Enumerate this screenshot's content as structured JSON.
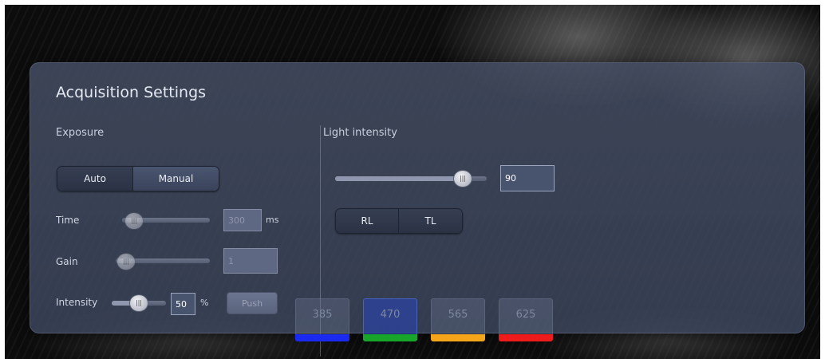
{
  "panel": {
    "title": "Acquisition Settings"
  },
  "exposure": {
    "label": "Exposure",
    "mode_options": [
      "Auto",
      "Manual"
    ],
    "time": {
      "label": "Time",
      "value": "300",
      "unit": "ms",
      "slider_fraction": 0.18
    },
    "gain": {
      "label": "Gain",
      "value": "1",
      "slider_fraction": 0.0
    },
    "intensity": {
      "label": "Intensity",
      "value": "50",
      "unit": "%",
      "slider_fraction": 0.5
    },
    "push_label": "Push"
  },
  "light": {
    "label": "Light intensity",
    "value": "90",
    "slider_fraction": 0.9,
    "source_options": [
      "RL",
      "TL"
    ]
  },
  "channels": [
    {
      "label": "385",
      "color": "#1a2af0",
      "selected": false
    },
    {
      "label": "470",
      "color": "#17a52a",
      "selected": true
    },
    {
      "label": "565",
      "color": "#f4a51a",
      "selected": false
    },
    {
      "label": "625",
      "color": "#ee1b1b",
      "selected": false
    }
  ]
}
